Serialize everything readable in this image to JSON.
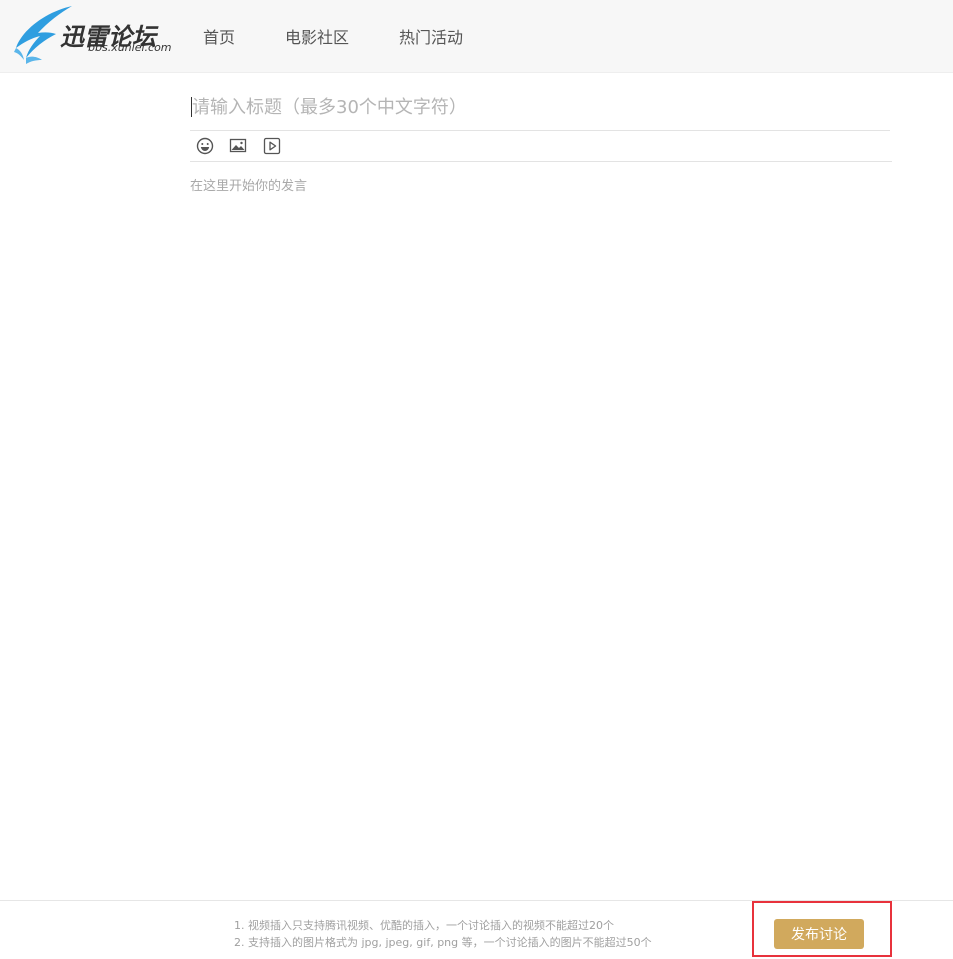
{
  "header": {
    "logo_title": "迅雷论坛",
    "logo_subtitle": "bbs.xunlei.com",
    "nav": [
      {
        "label": "首页"
      },
      {
        "label": "电影社区"
      },
      {
        "label": "热门活动"
      }
    ]
  },
  "editor": {
    "title_placeholder": "请输入标题（最多30个中文字符）",
    "title_value": "",
    "body_placeholder": "在这里开始你的发言",
    "body_value": "",
    "toolbar": {
      "icons": [
        "emoji-icon",
        "image-icon",
        "video-icon"
      ]
    }
  },
  "footer": {
    "tips": [
      "1. 视频插入只支持腾讯视频、优酷的插入，一个讨论插入的视频不能超过20个",
      "2. 支持插入的图片格式为 jpg, jpeg, gif, png 等，一个讨论插入的图片不能超过50个"
    ],
    "publish_label": "发布讨论"
  },
  "colors": {
    "accent": "#d1a95d",
    "highlight": "#e8323c",
    "logo_blue": "#2f9ee0"
  }
}
